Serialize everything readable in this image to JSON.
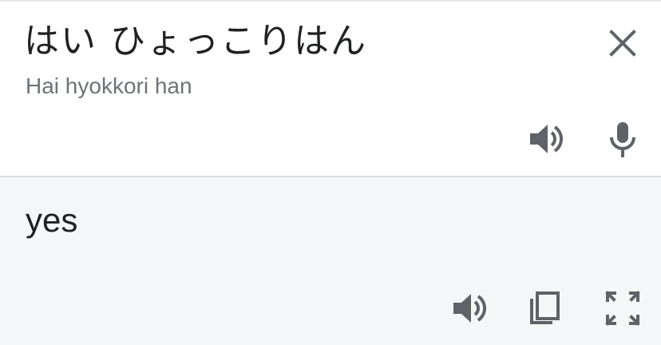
{
  "source": {
    "text": "はい ひょっこりはん",
    "romanization": "Hai hyokkori han"
  },
  "result": {
    "text": "yes"
  },
  "icons": {
    "close": "close-icon",
    "source_speaker": "volume-icon",
    "microphone": "mic-icon",
    "result_speaker": "volume-icon",
    "copy": "copy-icon",
    "fullscreen": "fullscreen-icon"
  },
  "colors": {
    "text_primary": "#202124",
    "text_secondary": "#6f7378",
    "icon": "#5f6368",
    "result_background": "#f5f6f8",
    "divider": "#dadce0"
  }
}
